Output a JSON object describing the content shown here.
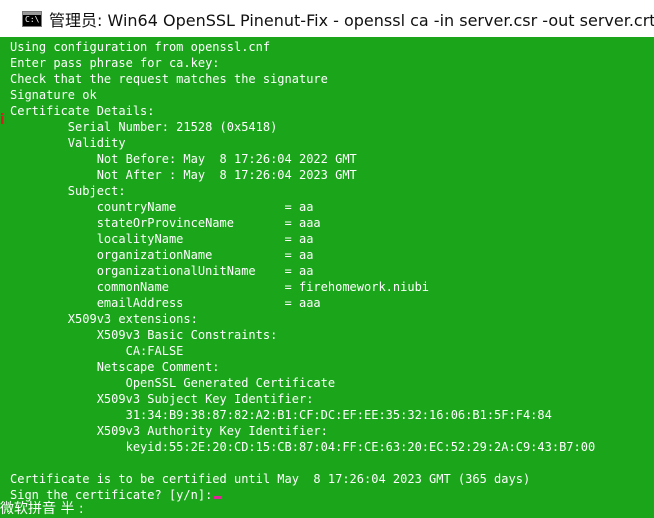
{
  "window": {
    "title": "管理员: Win64 OpenSSL Pinenut-Fix - openssl  ca -in server.csr -out server.crt -cert c",
    "icon": "console-app-icon",
    "icon_glyph": "C:\\"
  },
  "console": {
    "lines": [
      "Using configuration from openssl.cnf",
      "Enter pass phrase for ca.key:",
      "Check that the request matches the signature",
      "Signature ok",
      "Certificate Details:",
      "        Serial Number: 21528 (0x5418)",
      "        Validity",
      "            Not Before: May  8 17:26:04 2022 GMT",
      "            Not After : May  8 17:26:04 2023 GMT",
      "        Subject:",
      "            countryName               = aa",
      "            stateOrProvinceName       = aaa",
      "            localityName              = aa",
      "            organizationName          = aa",
      "            organizationalUnitName    = aa",
      "            commonName                = firehomework.niubi",
      "            emailAddress              = aaa",
      "        X509v3 extensions:",
      "            X509v3 Basic Constraints:",
      "                CA:FALSE",
      "            Netscape Comment:",
      "                OpenSSL Generated Certificate",
      "            X509v3 Subject Key Identifier:",
      "                31:34:B9:38:87:82:A2:B1:CF:DC:EF:EE:35:32:16:06:B1:5F:F4:84",
      "            X509v3 Authority Key Identifier:",
      "                keyid:55:2E:20:CD:15:CB:87:04:FF:CE:63:20:EC:52:29:2A:C9:43:B7:00",
      "",
      "Certificate is to be certified until May  8 17:26:04 2023 GMT (365 days)",
      "Sign the certificate? [y/n]:"
    ],
    "ime_status": "微软拼音 半 :"
  },
  "colors": {
    "background": "#1aa51a",
    "text": "#ffffff",
    "cursor": "#e0259a",
    "titlebar": "#ffffff"
  }
}
